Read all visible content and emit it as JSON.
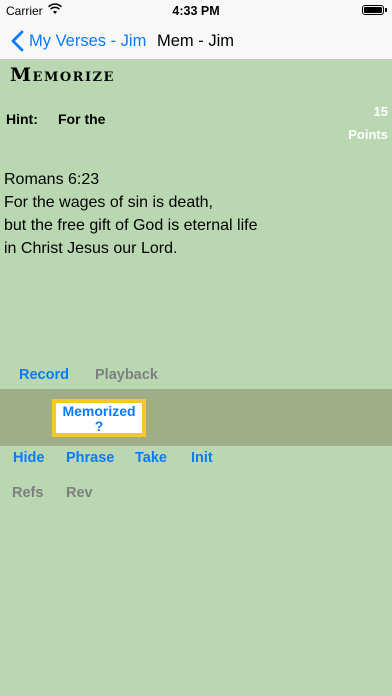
{
  "status_bar": {
    "carrier": "Carrier",
    "time": "4:33 PM",
    "icons": [
      "wifi-icon",
      "battery-icon"
    ]
  },
  "nav": {
    "back_label": "My Verses - Jim",
    "title": "Mem - Jim"
  },
  "page": {
    "title": "Memorize"
  },
  "hint": {
    "label": "Hint:",
    "text": "For the"
  },
  "points": {
    "value": "15",
    "label": "Points"
  },
  "verse": {
    "reference": "Romans 6:23",
    "lines": [
      "For the wages of sin is death,",
      "but the free gift of God is eternal life",
      "in Christ Jesus our Lord."
    ]
  },
  "controls": {
    "record": "Record",
    "playback": "Playback",
    "memorized_line1": "Memorized",
    "memorized_line2": "?",
    "hide": "Hide",
    "phrase": "Phrase",
    "take": "Take",
    "init": "Init",
    "refs": "Refs",
    "rev": "Rev"
  },
  "colors": {
    "background": "#b9d7b1",
    "band": "#9fad88",
    "accent": "#0a7aff",
    "disabled": "#7f7f7f",
    "highlight_border": "#f3c82c"
  }
}
